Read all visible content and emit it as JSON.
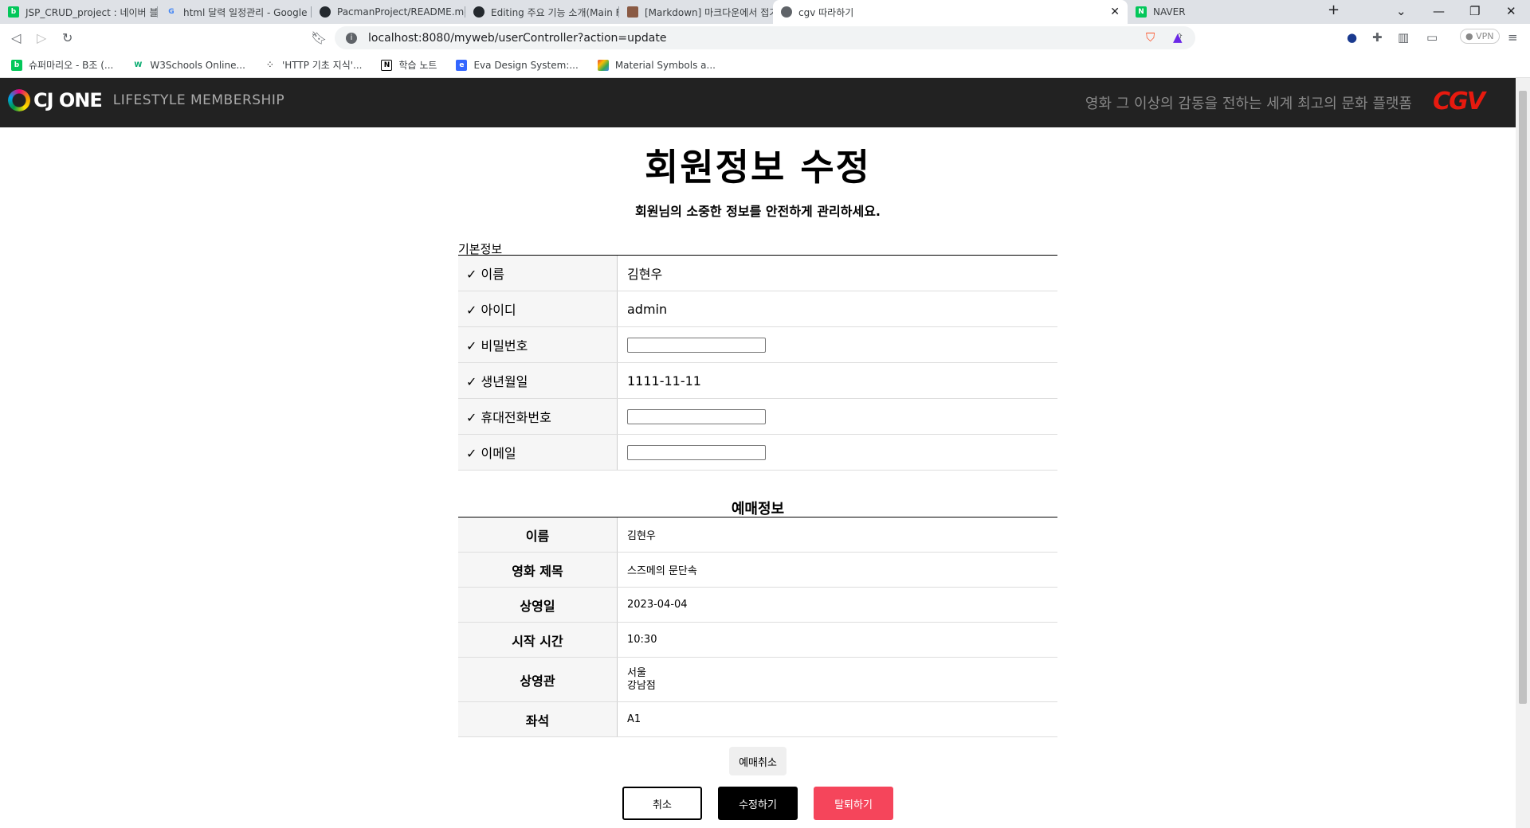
{
  "browser": {
    "tabs": [
      {
        "label": "JSP_CRUD_project : 네이버 블로그",
        "icon": "N"
      },
      {
        "label": "html 달력 일정관리 - Google 검색",
        "icon": "G"
      },
      {
        "label": "PacmanProject/README.md at main",
        "icon": "gh"
      },
      {
        "label": "Editing 주요 기능 소개(Main Frame)",
        "icon": "gh"
      },
      {
        "label": "[Markdown] 마크다운에서 접기/펼치",
        "icon": "img"
      },
      {
        "label": "cgv 따라하기",
        "icon": "globe"
      },
      {
        "label": "NAVER",
        "icon": "N"
      }
    ],
    "url": "localhost:8080/myweb/userController?action=update",
    "vpn_label": "VPN",
    "bookmarks": [
      "슈퍼마리오 - B조 (...",
      "W3Schools Online...",
      "'HTTP 기초 지식'...",
      "학습 노트",
      "Eva Design System:...",
      "Material Symbols a..."
    ]
  },
  "header": {
    "brand": "CJ ONE",
    "tagline": "LIFESTYLE MEMBERSHIP",
    "slogan": "영화 그 이상의 감동을 전하는 세계 최고의 문화 플랫폼",
    "cgv": "CGV"
  },
  "page": {
    "title": "회원정보 수정",
    "subtitle": "회원님의 소중한 정보를 안전하게 관리하세요.",
    "basic_label": "기본정보",
    "basic_rows": [
      {
        "label": "✓ 이름",
        "value": "김현우"
      },
      {
        "label": "✓ 아이디",
        "value": "admin"
      },
      {
        "label": "✓ 비밀번호",
        "value": ""
      },
      {
        "label": "✓ 생년월일",
        "value": "1111-11-11"
      },
      {
        "label": "✓ 휴대전화번호",
        "value": ""
      },
      {
        "label": "✓ 이메일",
        "value": ""
      }
    ],
    "reservation_title": "예매정보",
    "reservation_rows": [
      {
        "label": "이름",
        "value": "김현우"
      },
      {
        "label": "영화 제목",
        "value": "스즈메의 문단속"
      },
      {
        "label": "상영일",
        "value": "2023-04-04"
      },
      {
        "label": "시작 시간",
        "value": "10:30"
      },
      {
        "label": "상영관",
        "value": "서울",
        "value2": "강남점"
      },
      {
        "label": "좌석",
        "value": "A1"
      }
    ],
    "cancel_reservation": "예매취소",
    "buttons": {
      "cancel": "취소",
      "update": "수정하기",
      "withdraw": "탈퇴하기"
    }
  }
}
